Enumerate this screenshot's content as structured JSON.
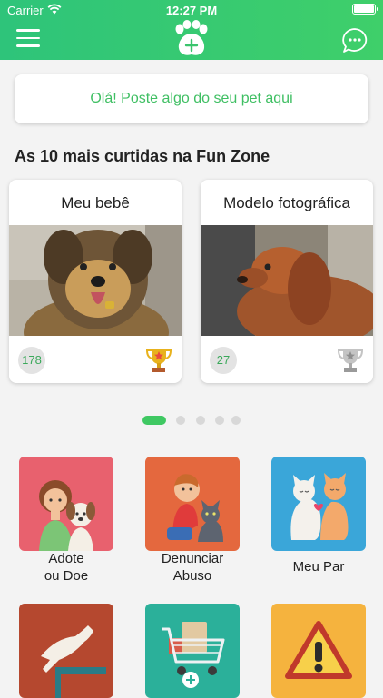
{
  "status": {
    "carrier": "Carrier",
    "time": "12:27 PM"
  },
  "header": {
    "menu_icon": "hamburger-icon",
    "logo_icon": "paw-plus-icon",
    "chat_icon": "chat-bubble-icon"
  },
  "post": {
    "placeholder": "Olá! Poste algo do seu pet aqui"
  },
  "top10": {
    "title": "As 10 mais curtidas na Fun Zone",
    "cards": [
      {
        "title": "Meu bebê",
        "likes": "178",
        "trophy": "gold-trophy-icon",
        "trophy_color": "#e8b21d"
      },
      {
        "title": "Modelo fotográfica",
        "likes": "27",
        "trophy": "silver-trophy-icon",
        "trophy_color": "#b8b8b8"
      }
    ],
    "pages": 5,
    "active_page": 1
  },
  "menu": [
    {
      "label_line1": "Adote",
      "label_line2": "ou Doe",
      "icon": "girl-with-dog-icon",
      "color": "#e8616e"
    },
    {
      "label_line1": "Denunciar",
      "label_line2": "Abuso",
      "icon": "boy-with-cat-icon",
      "color": "#e4683e"
    },
    {
      "label_line1": "Meu Par",
      "label_line2": "",
      "icon": "cats-couple-icon",
      "color": "#3aa6d9"
    },
    {
      "icon": "dog-jumping-icon",
      "color": "#b5482f"
    },
    {
      "icon": "shopping-cart-icon",
      "color": "#2bb09a"
    },
    {
      "icon": "warning-icon",
      "color": "#f5b33e"
    }
  ]
}
